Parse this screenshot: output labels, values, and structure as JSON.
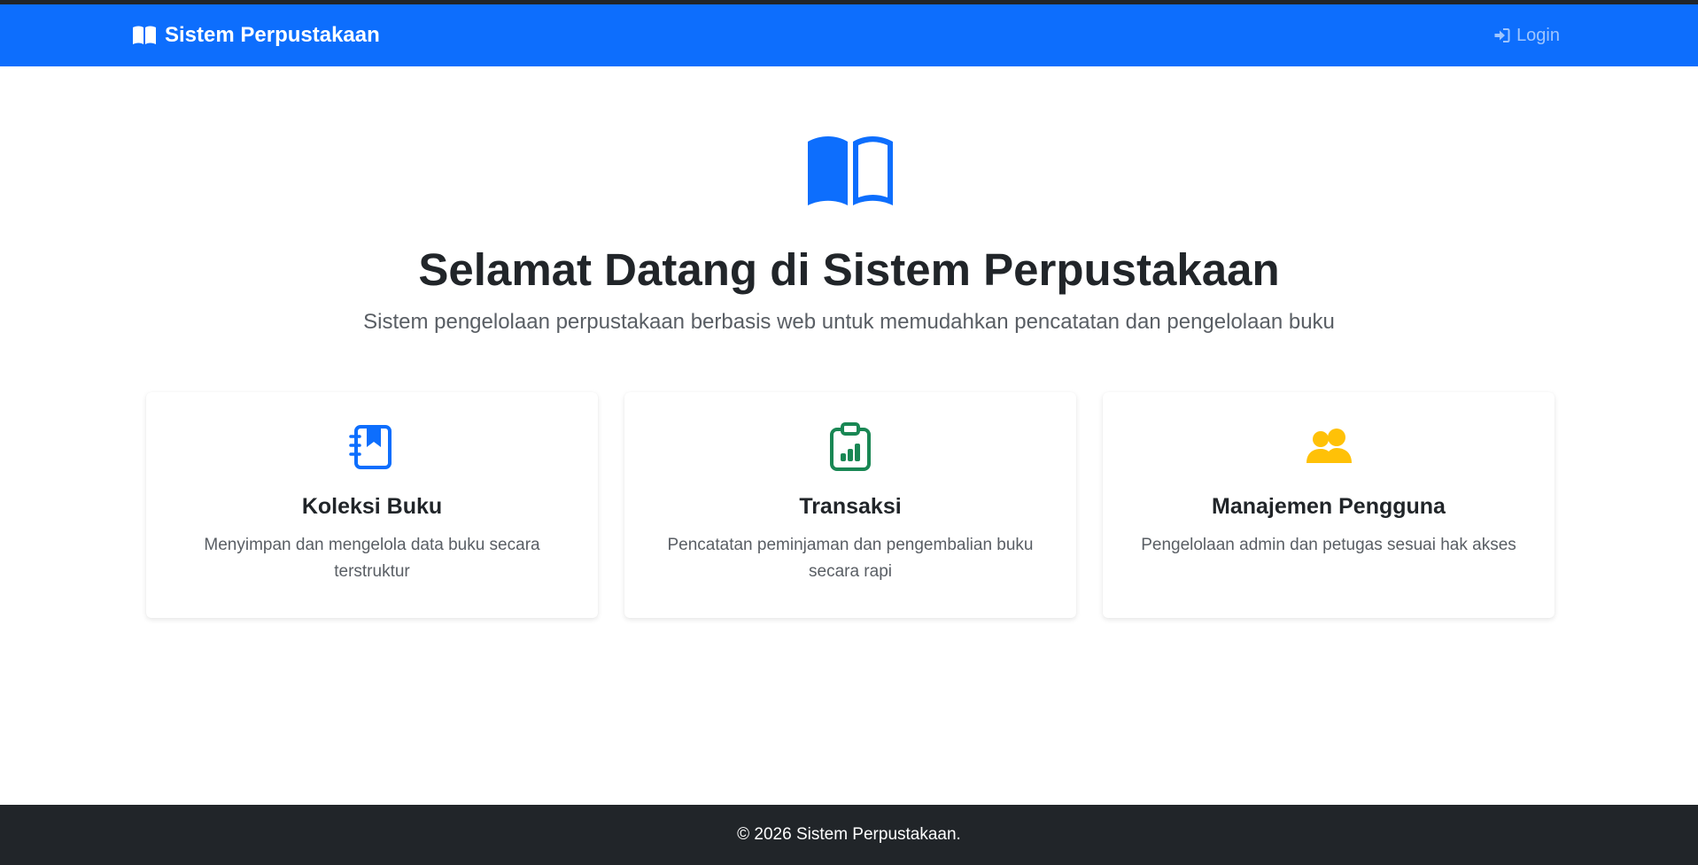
{
  "nav": {
    "brand": "Sistem Perpustakaan",
    "brand_icon": "book-open-icon",
    "login_label": "Login",
    "login_icon": "sign-in-icon"
  },
  "hero": {
    "icon": "book-open-icon",
    "title": "Selamat Datang di Sistem Perpustakaan",
    "subtitle": "Sistem pengelolaan perpustakaan berbasis web untuk memudahkan pencatatan dan pengelolaan buku"
  },
  "features": [
    {
      "icon": "journal-bookmark-icon",
      "icon_color": "#0d6efd",
      "title": "Koleksi Buku",
      "description": "Menyimpan dan mengelola data buku secara terstruktur"
    },
    {
      "icon": "clipboard-data-icon",
      "icon_color": "#198754",
      "title": "Transaksi",
      "description": "Pencatatan peminjaman dan pengembalian buku secara rapi"
    },
    {
      "icon": "people-icon",
      "icon_color": "#ffc107",
      "title": "Manajemen Pengguna",
      "description": "Pengelolaan admin dan petugas sesuai hak akses"
    }
  ],
  "footer": {
    "text": "© 2026 Sistem Perpustakaan."
  },
  "colors": {
    "primary": "#0d6efd",
    "dark": "#212529",
    "success": "#198754",
    "warning": "#ffc107"
  }
}
